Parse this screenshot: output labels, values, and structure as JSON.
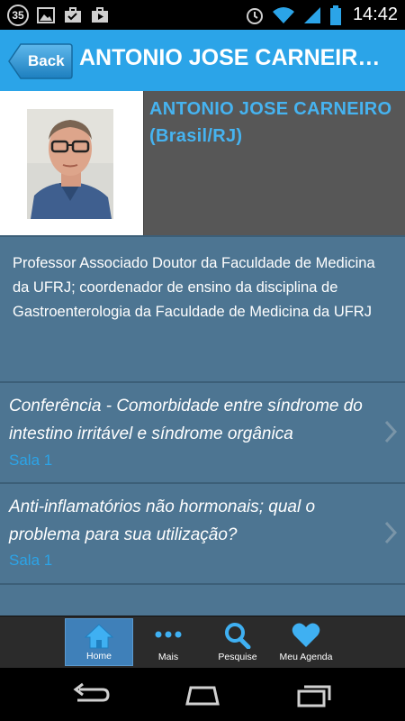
{
  "status_bar": {
    "badge": "35",
    "time": "14:42",
    "icons": [
      "image-icon",
      "briefcase-check-icon",
      "briefcase-play-icon",
      "alarm-icon",
      "wifi-icon",
      "signal-icon",
      "battery-icon"
    ]
  },
  "header": {
    "back_label": "Back",
    "title": "ANTONIO JOSE CARNEIRO (Brasil/RJ)"
  },
  "profile": {
    "name": "ANTONIO JOSE CARNEIRO (Brasil/RJ)",
    "bio": "Professor Associado Doutor da Faculdade de Medicina da UFRJ; coordenador de ensino da disciplina de Gastroenterologia da Faculdade de Medicina da UFRJ"
  },
  "sessions": [
    {
      "title": "Conferência  - Comorbidade entre síndrome do intestino irritável e síndrome orgânica",
      "room": "Sala 1"
    },
    {
      "title": "Anti-inflamatórios não hormonais; qual o problema para sua utilização?",
      "room": "Sala 1"
    }
  ],
  "tabs": [
    {
      "label": "Home",
      "icon": "home-icon",
      "active": true
    },
    {
      "label": "Mais",
      "icon": "more-icon",
      "active": false
    },
    {
      "label": "Pesquise",
      "icon": "search-icon",
      "active": false
    },
    {
      "label": "Meu Agenda",
      "icon": "heart-icon",
      "active": false
    }
  ],
  "colors": {
    "accent": "#2ba4e8",
    "panel": "#4d7592",
    "profile_bg": "#575757",
    "name_color": "#46b3f0"
  }
}
